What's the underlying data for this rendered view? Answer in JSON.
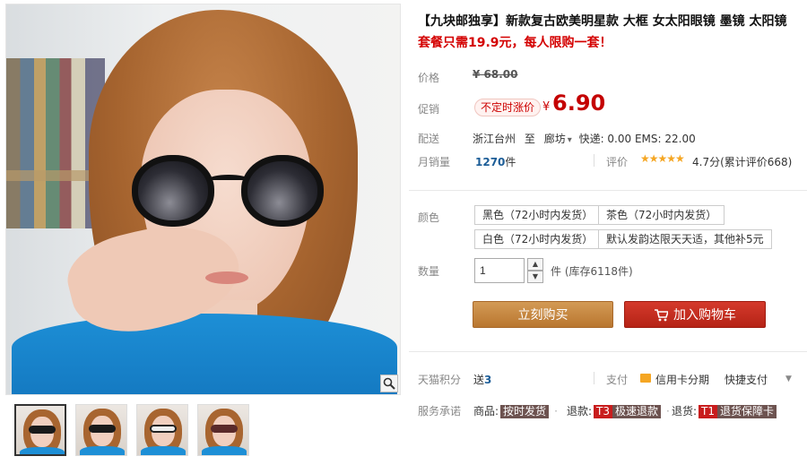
{
  "product": {
    "title": "【九块邮独享】新款复古欧美明星款 大框 女太阳眼镜 墨镜 太阳镜",
    "subtitle": "套餐只需19.9元，每人限购一套！"
  },
  "price": {
    "label": "价格",
    "original": "¥ 68.00"
  },
  "promo": {
    "label": "促销",
    "tag": "不定时涨价",
    "currency": "¥",
    "price": "6.90"
  },
  "shipping": {
    "label": "配送",
    "from": "浙江台州",
    "to_word": "至",
    "destination": "廊坊",
    "fees": "快递: 0.00 EMS: 22.00"
  },
  "sales": {
    "label": "月销量",
    "count": "1270",
    "unit": "件",
    "eval_label": "评价",
    "stars": "★★★★★",
    "score_text": "4.7分(累计评价668)"
  },
  "colors": {
    "label": "颜色",
    "options": [
      "黑色（72小时内发货）",
      "茶色（72小时内发货）",
      "白色（72小时内发货）",
      "默认发韵达限天天适，其他补5元"
    ]
  },
  "quantity": {
    "label": "数量",
    "value": "1",
    "up": "▲",
    "down": "▼",
    "stock_text": "件 (库存6118件)"
  },
  "actions": {
    "buy_now": "立刻购买",
    "add_to_cart": "加入购物车"
  },
  "points": {
    "label": "天猫积分",
    "value_prefix": "送",
    "value": "3"
  },
  "payment": {
    "label": "支付",
    "card_text": "信用卡分期",
    "quick_pay": "快捷支付",
    "caret": "▼"
  },
  "service": {
    "label": "服务承诺",
    "goods_label": "商品:",
    "goods_tag": "按时发货",
    "refund_label": "退款:",
    "refund_code": "T3",
    "refund_tag": "极速退款",
    "return_label": "退货:",
    "return_code": "T1",
    "return_tag": "退货保障卡",
    "sep": "·"
  },
  "theme": {
    "accent_red": "#c40000",
    "buy_brown": "#c4853e",
    "cart_red": "#c42b1c",
    "link_blue": "#1c5d97",
    "star_gold": "#f5a623"
  }
}
